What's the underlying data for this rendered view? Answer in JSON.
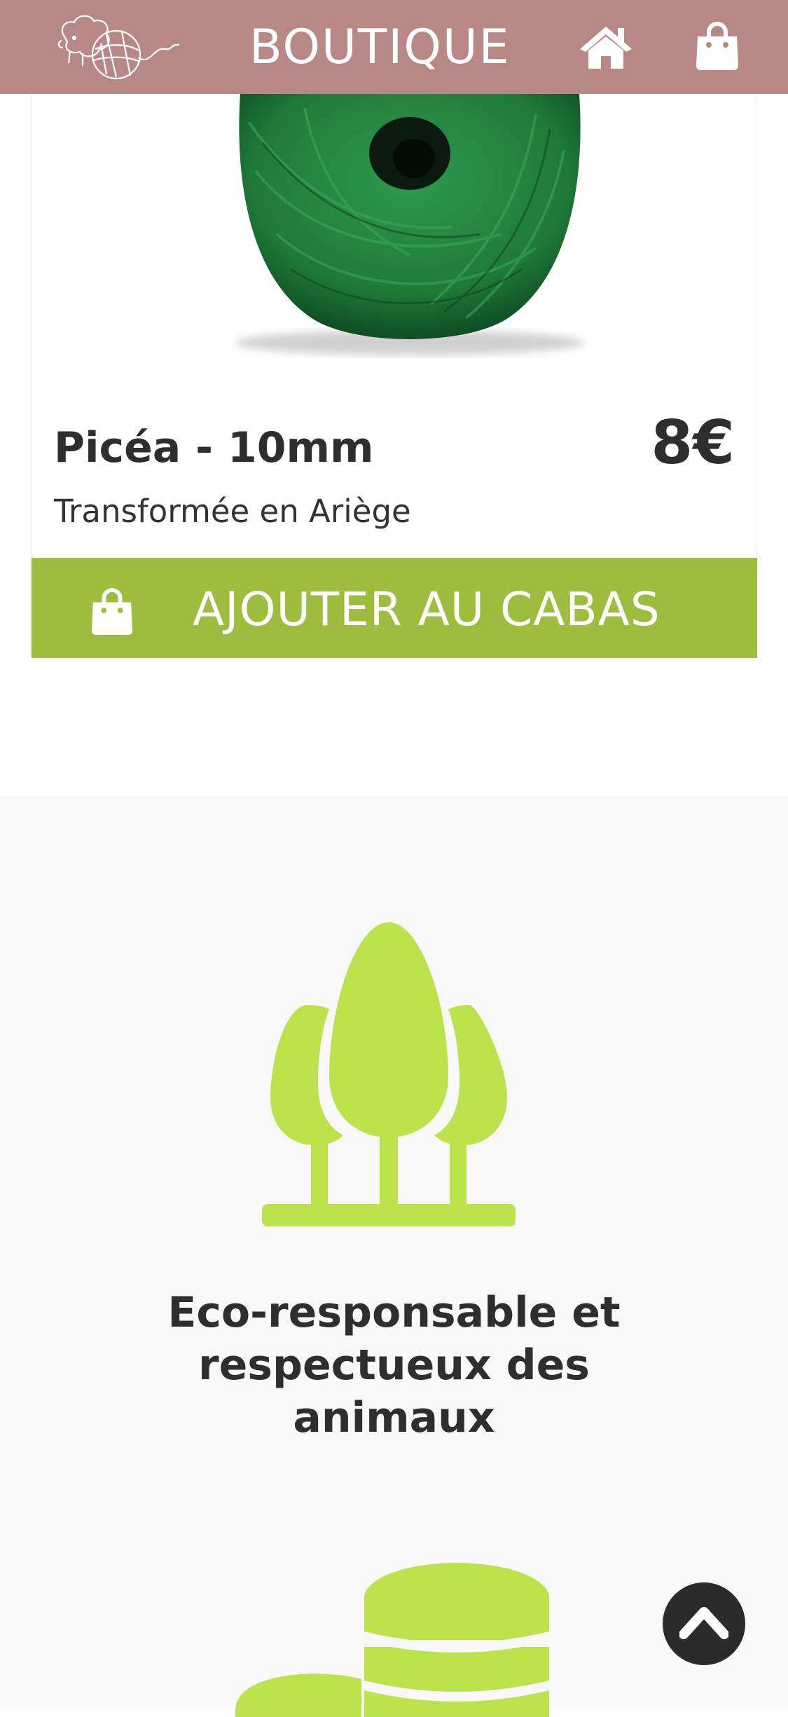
{
  "header": {
    "title": "BOUTIQUE",
    "icons": [
      "yarn-sheep-logo",
      "home-icon",
      "shopping-bag-icon"
    ]
  },
  "product": {
    "name": "Picéa - 10mm",
    "price": "8€",
    "origin": "Transformée en Ariège",
    "add_to_cart_label": "AJOUTER AU CABAS",
    "image_color": "#1f7a3a"
  },
  "features": {
    "item1_icon": "trees-icon",
    "item1_title": "Eco-responsable et respectueux des animaux",
    "item2_icon": "coins-icon"
  },
  "colors": {
    "header": "#b88887",
    "button": "#9cbd3e",
    "icon_green": "#bce34c",
    "section_bg": "#f8f8f8"
  },
  "scroll_top_icon": "chevron-up-icon"
}
